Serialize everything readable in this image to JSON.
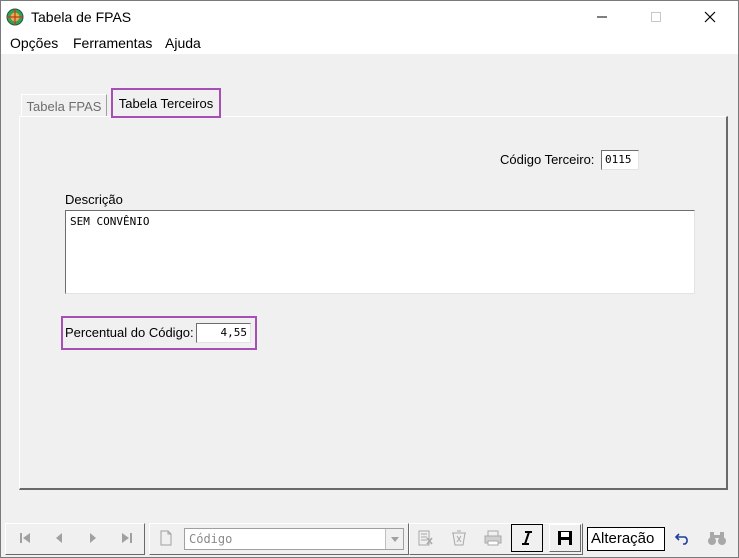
{
  "window": {
    "title": "Tabela de FPAS"
  },
  "menu": {
    "items": [
      "Opções",
      "Ferramentas",
      "Ajuda"
    ]
  },
  "tabs": [
    {
      "label": "Tabela FPAS",
      "active": false
    },
    {
      "label": "Tabela Terceiros",
      "active": true
    }
  ],
  "form": {
    "codigo_terceiro_label": "Código Terceiro:",
    "codigo_terceiro_value": "0115",
    "descricao_label": "Descrição",
    "descricao_value": "SEM CONVÊNIO",
    "percentual_label": "Percentual do Código:",
    "percentual_value": "4,55"
  },
  "toolbar": {
    "search_field_placeholder": "Código",
    "status_text": "Alteração",
    "buttons": [
      "first-record-icon",
      "prev-record-icon",
      "next-record-icon",
      "last-record-icon",
      "new-document-icon",
      "delete-icon",
      "cancel-icon",
      "print-icon",
      "edit-icon",
      "save-icon",
      "undo-icon",
      "find-binoculars-icon"
    ]
  },
  "colors": {
    "highlight": "#a64fb5",
    "window_bg": "#f0f0f0"
  }
}
